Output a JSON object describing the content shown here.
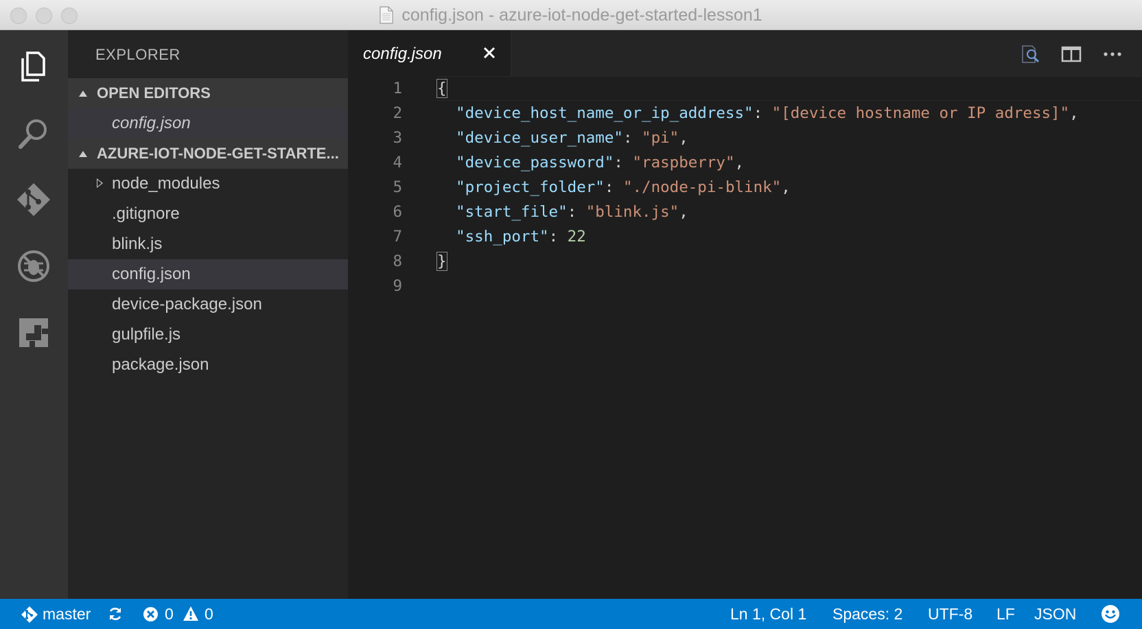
{
  "window": {
    "title": "config.json - azure-iot-node-get-started-lesson1"
  },
  "activity_bar": {
    "items": [
      {
        "icon": "files-icon",
        "active": true
      },
      {
        "icon": "search-icon",
        "active": false
      },
      {
        "icon": "git-icon",
        "active": false
      },
      {
        "icon": "debug-icon",
        "active": false
      },
      {
        "icon": "extensions-icon",
        "active": false
      }
    ]
  },
  "sidebar": {
    "title": "EXPLORER",
    "open_editors": {
      "header": "OPEN EDITORS",
      "items": [
        "config.json"
      ]
    },
    "folder": {
      "header": "AZURE-IOT-NODE-GET-STARTE...",
      "items": [
        "node_modules",
        ".gitignore",
        "blink.js",
        "config.json",
        "device-package.json",
        "gulpfile.js",
        "package.json"
      ],
      "selected": "config.json"
    }
  },
  "editor": {
    "tab": {
      "label": "config.json",
      "close_icon": "close-icon"
    },
    "actions": [
      "open-preview-icon",
      "split-editor-icon",
      "more-actions-icon"
    ],
    "lines": [
      {
        "n": "1",
        "tokens": [
          {
            "t": "{",
            "c": "p",
            "bracket": true
          }
        ]
      },
      {
        "n": "2",
        "tokens": [
          {
            "t": "  ",
            "c": "p"
          },
          {
            "t": "\"device_host_name_or_ip_address\"",
            "c": "k"
          },
          {
            "t": ": ",
            "c": "p"
          },
          {
            "t": "\"[device hostname or IP adress]\"",
            "c": "s"
          },
          {
            "t": ",",
            "c": "p"
          }
        ]
      },
      {
        "n": "3",
        "tokens": [
          {
            "t": "  ",
            "c": "p"
          },
          {
            "t": "\"device_user_name\"",
            "c": "k"
          },
          {
            "t": ": ",
            "c": "p"
          },
          {
            "t": "\"pi\"",
            "c": "s"
          },
          {
            "t": ",",
            "c": "p"
          }
        ]
      },
      {
        "n": "4",
        "tokens": [
          {
            "t": "  ",
            "c": "p"
          },
          {
            "t": "\"device_password\"",
            "c": "k"
          },
          {
            "t": ": ",
            "c": "p"
          },
          {
            "t": "\"raspberry\"",
            "c": "s"
          },
          {
            "t": ",",
            "c": "p"
          }
        ]
      },
      {
        "n": "5",
        "tokens": [
          {
            "t": "  ",
            "c": "p"
          },
          {
            "t": "\"project_folder\"",
            "c": "k"
          },
          {
            "t": ": ",
            "c": "p"
          },
          {
            "t": "\"./node-pi-blink\"",
            "c": "s"
          },
          {
            "t": ",",
            "c": "p"
          }
        ]
      },
      {
        "n": "6",
        "tokens": [
          {
            "t": "  ",
            "c": "p"
          },
          {
            "t": "\"start_file\"",
            "c": "k"
          },
          {
            "t": ": ",
            "c": "p"
          },
          {
            "t": "\"blink.js\"",
            "c": "s"
          },
          {
            "t": ",",
            "c": "p"
          }
        ]
      },
      {
        "n": "7",
        "tokens": [
          {
            "t": "  ",
            "c": "p"
          },
          {
            "t": "\"ssh_port\"",
            "c": "k"
          },
          {
            "t": ": ",
            "c": "p"
          },
          {
            "t": "22",
            "c": "n"
          }
        ]
      },
      {
        "n": "8",
        "tokens": [
          {
            "t": "}",
            "c": "p",
            "bracket": true
          }
        ]
      },
      {
        "n": "9",
        "tokens": []
      }
    ]
  },
  "status_bar": {
    "branch": "master",
    "errors": "0",
    "warnings": "0",
    "position": "Ln 1, Col 1",
    "indent": "Spaces: 2",
    "encoding": "UTF-8",
    "eol": "LF",
    "language": "JSON",
    "feedback_icon": "smiley-icon"
  },
  "colors": {
    "status_bar": "#007acc",
    "activity_bar": "#333333",
    "sidebar": "#252526",
    "editor": "#1e1e1e",
    "key": "#9cdcfe",
    "string": "#ce9178",
    "number": "#b5cea8"
  }
}
